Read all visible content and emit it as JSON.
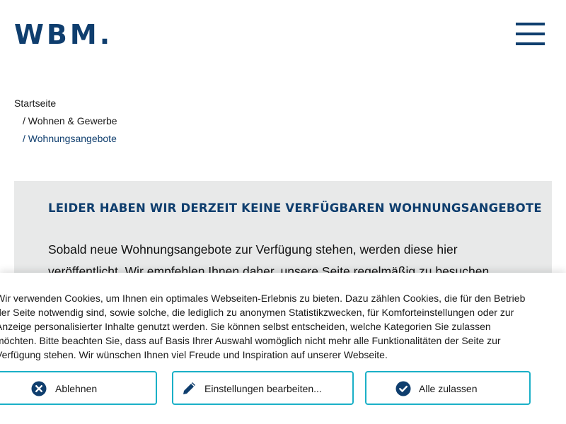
{
  "header": {
    "logo_text": "WBM.",
    "menu_icon": "hamburger-menu-icon"
  },
  "breadcrumb": {
    "items": [
      {
        "label": "Startseite"
      },
      {
        "label": "/ Wohnen & Gewerbe"
      },
      {
        "label": "/ Wohnungsangebote"
      }
    ]
  },
  "notice": {
    "title": "LEIDER HABEN WIR DERZEIT KEINE VERFÜGBAREN WOHNUNGSANGEBOTE",
    "text": "Sobald neue Wohnungsangebote zur Verfügung stehen, werden diese hier veröffentlicht. Wir empfehlen Ihnen daher, unsere Seite regelmäßig zu besuchen."
  },
  "cookie_banner": {
    "text": "Wir verwenden Cookies, um Ihnen ein optimales Webseiten-Erlebnis zu bieten. Dazu zählen Cookies, die für den Betrieb\nder Seite notwendig sind, sowie solche, die lediglich zu anonymen Statistikzwecken, für Komforteinstellungen oder zur\nAnzeige personalisierter Inhalte genutzt werden. Sie können selbst entscheiden, welche Kategorien Sie zulassen\nmöchten. Bitte beachten Sie, dass auf Basis Ihrer Auswahl womöglich nicht mehr alle Funktionalitäten der Seite zur\nVerfügung stehen. Wir wünschen Ihnen viel Freude und Inspiration auf unserer Webseite.",
    "buttons": {
      "reject": {
        "label": "Ablehnen",
        "icon": "x-circle-icon"
      },
      "settings": {
        "label": "Einstellungen bearbeiten...",
        "icon": "pencil-icon"
      },
      "accept": {
        "label": "Alle zulassen",
        "icon": "check-circle-icon"
      }
    }
  },
  "colors": {
    "brand": "#0f3e6e",
    "notice_background": "#e8e9e9",
    "button_border": "#1ab0c7"
  }
}
